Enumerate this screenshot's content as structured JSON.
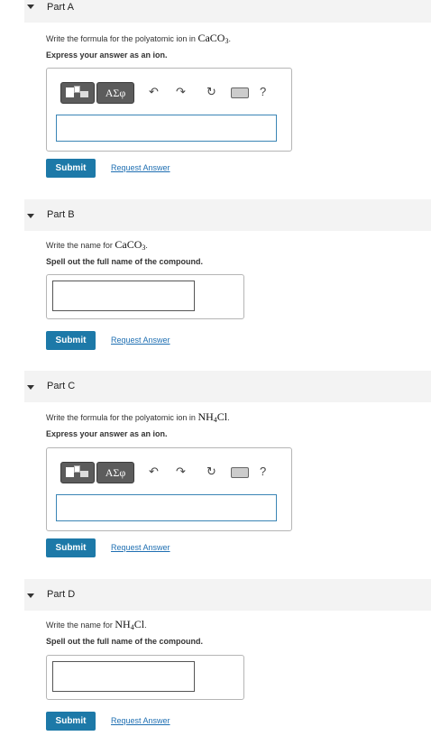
{
  "toolbar": {
    "greek_label": "ΑΣφ",
    "help_label": "?"
  },
  "parts": [
    {
      "title": "Part A",
      "prompt_prefix": "Write the formula for the polyatomic ion in",
      "compound": "CaCO",
      "compound_sub": "3",
      "compound_suffix": "",
      "prompt_end": ".",
      "instruction": "Express your answer as an ion.",
      "answer_value": "",
      "submit_label": "Submit",
      "request_label": "Request Answer"
    },
    {
      "title": "Part B",
      "prompt_prefix": "Write the name for",
      "compound": "CaCO",
      "compound_sub": "3",
      "compound_suffix": "",
      "prompt_end": ".",
      "instruction": "Spell out the full name of the compound.",
      "answer_value": "",
      "submit_label": "Submit",
      "request_label": "Request Answer"
    },
    {
      "title": "Part C",
      "prompt_prefix": "Write the formula for the polyatomic ion in",
      "compound": "NH",
      "compound_sub": "4",
      "compound_suffix": "Cl",
      "prompt_end": ".",
      "instruction": "Express your answer as an ion.",
      "answer_value": "",
      "submit_label": "Submit",
      "request_label": "Request Answer"
    },
    {
      "title": "Part D",
      "prompt_prefix": "Write the name for",
      "compound": "NH",
      "compound_sub": "4",
      "compound_suffix": "Cl",
      "prompt_end": ".",
      "instruction": "Spell out the full name of the compound.",
      "answer_value": "",
      "submit_label": "Submit",
      "request_label": "Request Answer"
    }
  ]
}
